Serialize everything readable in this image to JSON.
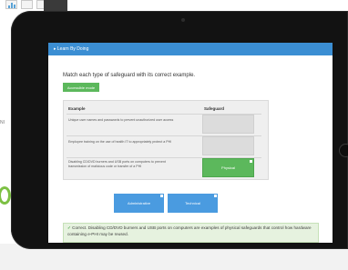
{
  "header": {
    "title": "▸ Learn By Doing"
  },
  "instruction": "Match each type of safeguard with its correct example.",
  "accessible_button": "Accessible mode",
  "table": {
    "col_example": "Example",
    "col_safeguard": "Safeguard",
    "rows": [
      {
        "example": "Unique user names and passwords to prevent unauthorized user access",
        "slot": ""
      },
      {
        "example": "Employee training on the use of health IT to appropriately protect a PHI",
        "slot": ""
      },
      {
        "example": "Disabling CD/DVD burners and USB ports on computers to prevent transmission of malicious code or transfer of a PHI",
        "slot": "Physical"
      }
    ]
  },
  "choices": [
    "Administrative",
    "Technical"
  ],
  "feedback": {
    "icon": "✓",
    "text": "Correct. Disabling CD/DVD burners and USB ports on computers are examples of physical safeguards that control how hardware containing e-PHI may be reused."
  },
  "colors": {
    "header": "#3b8ed3",
    "correct_green": "#5cb85c",
    "choice_blue": "#4a9be0",
    "feedback_bg": "#e6f2df"
  }
}
